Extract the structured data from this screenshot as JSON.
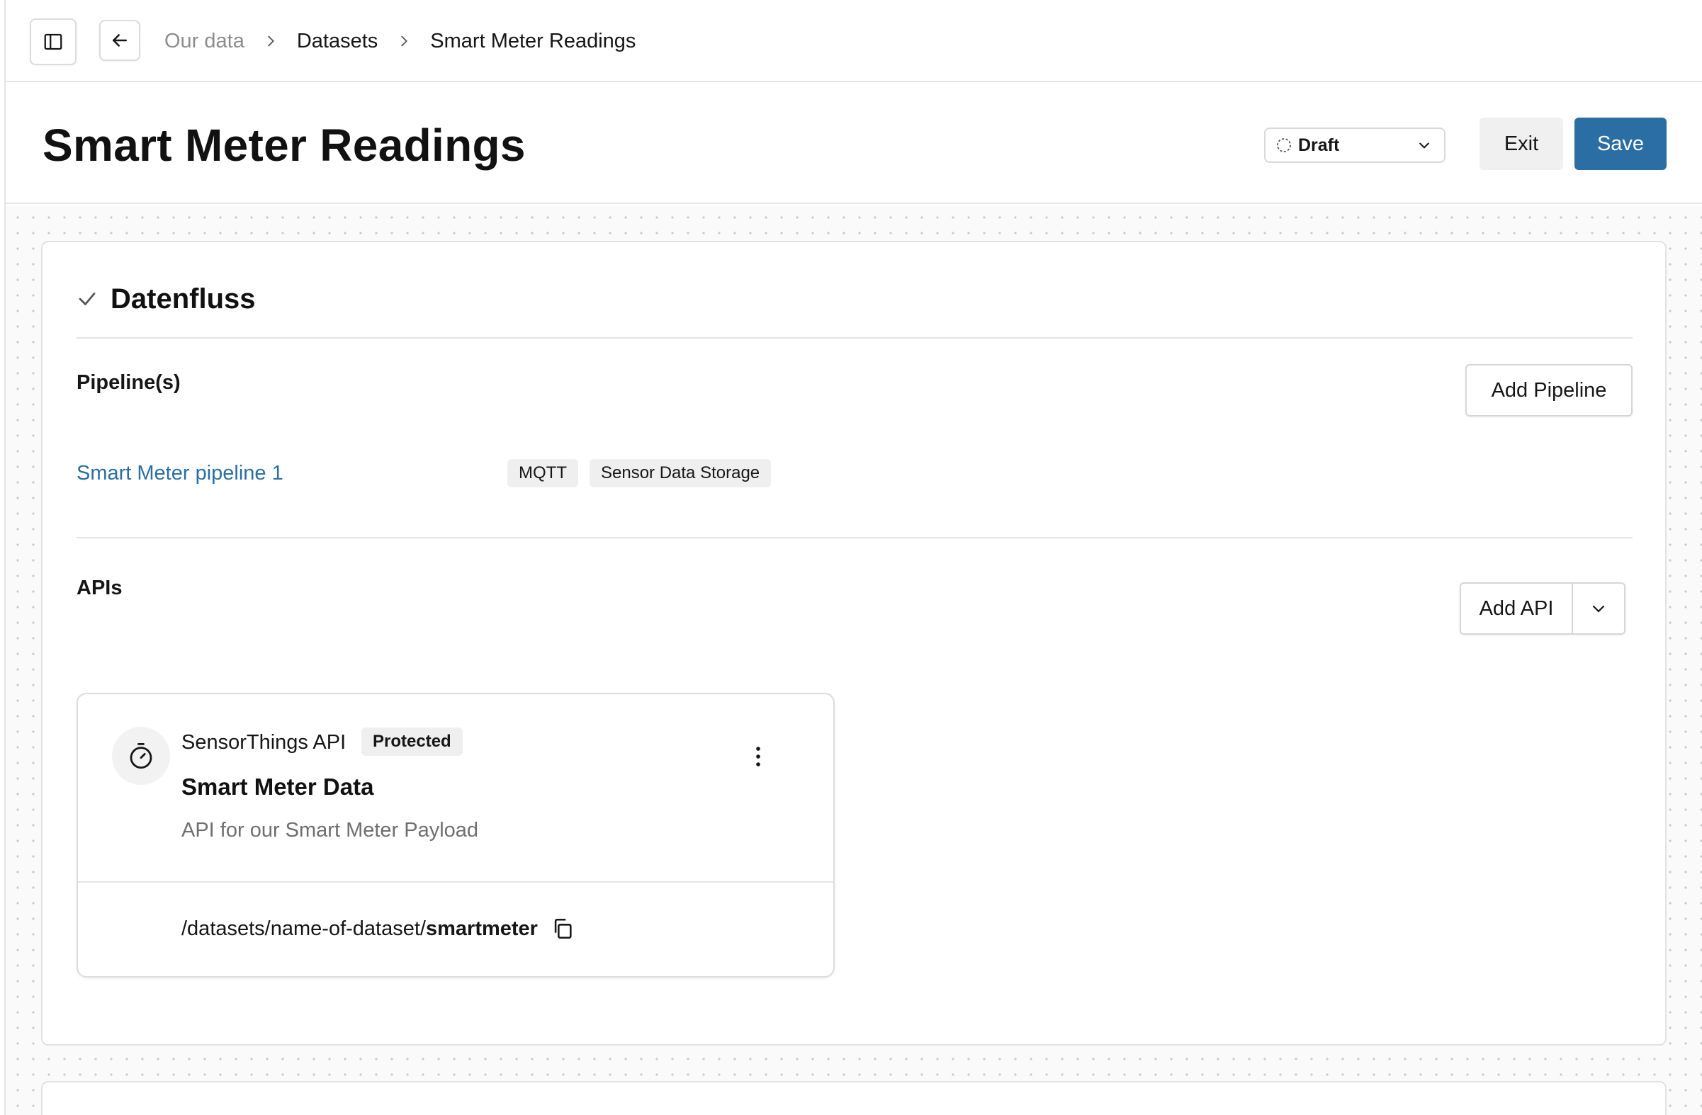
{
  "breadcrumb": {
    "items": [
      "Our data",
      "Datasets",
      "Smart Meter Readings"
    ]
  },
  "header": {
    "title": "Smart Meter Readings",
    "status": "Draft",
    "exit_label": "Exit",
    "save_label": "Save"
  },
  "section": {
    "title": "Datenfluss",
    "pipelines_label": "Pipeline(s)",
    "add_pipeline_label": "Add Pipeline",
    "pipelines": [
      {
        "name": "Smart Meter pipeline 1",
        "tags": [
          "MQTT",
          "Sensor Data Storage"
        ]
      }
    ],
    "apis_label": "APIs",
    "add_api_label": "Add API",
    "api_card": {
      "type": "SensorThings API",
      "badge": "Protected",
      "name": "Smart Meter Data",
      "description": "API for our Smart Meter Payload",
      "path_prefix": "/datasets/name-of-dataset/",
      "path_bold": "smartmeter"
    }
  },
  "colors": {
    "primary": "#2b6ea4",
    "link": "#2b6ea4",
    "muted_text": "#8d8d8d"
  }
}
